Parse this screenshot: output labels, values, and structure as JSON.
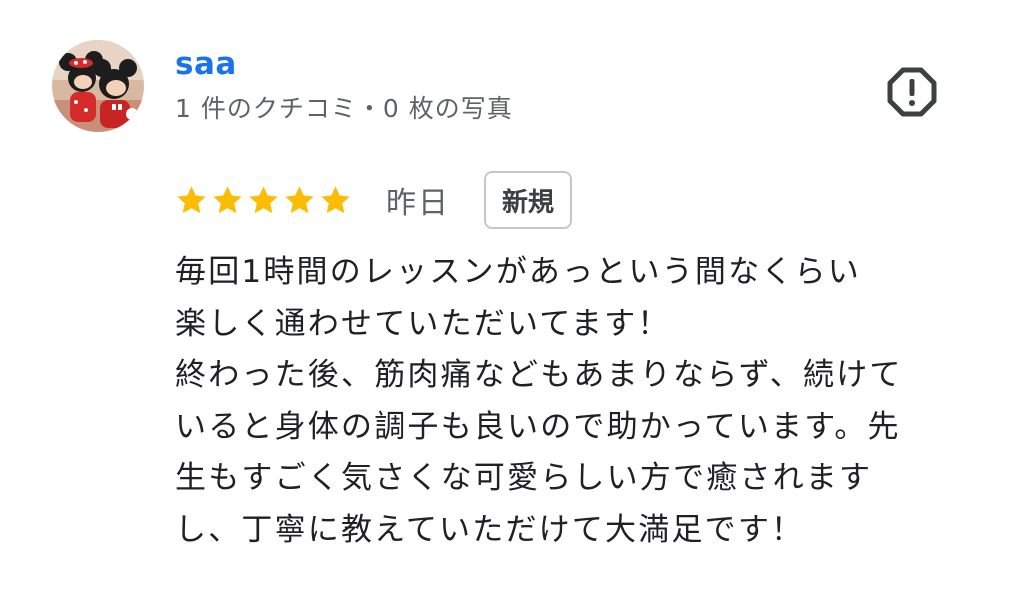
{
  "reviewer": {
    "name": "saa",
    "meta": "1 件のクチコミ・0 枚の写真",
    "name_color": "#1a73e8"
  },
  "review": {
    "rating": 5,
    "rating_max": 5,
    "star_color": "#fbbc04",
    "date": "昨日",
    "badge": "新規",
    "text_lines": [
      "毎回1時間のレッスンがあっという間なくらい",
      "楽しく通わせていただいてます！",
      "終わった後、筋肉痛などもあまりならず、続けて",
      "いると身体の調子も良いので助かっています。先",
      "生もすごく気さくな可愛らしい方で癒されます",
      "し、丁寧に教えていただけて大満足です！"
    ]
  },
  "icons": {
    "avatar": "profile-photo",
    "flag": "report-flag-icon",
    "star": "star-icon"
  }
}
